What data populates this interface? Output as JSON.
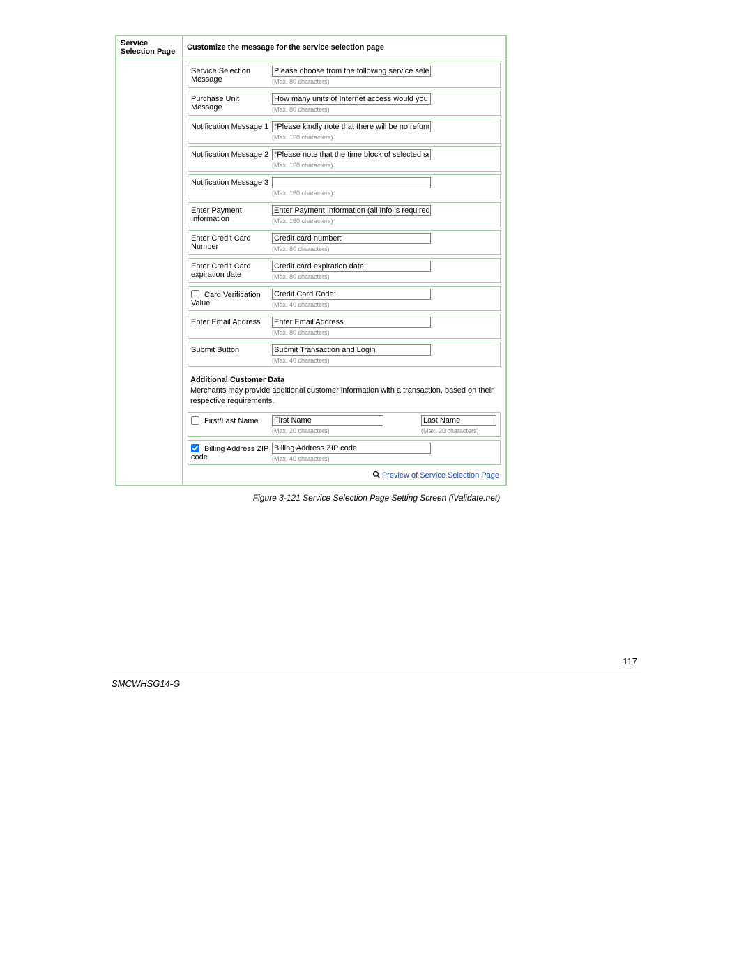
{
  "panel": {
    "left_header": "Service Selection Page",
    "right_header": "Customize the message for the service selection page"
  },
  "rows": {
    "service_selection": {
      "label": "Service Selection Message",
      "value": "Please choose from the following service selection",
      "hint": "(Max. 80 characters)"
    },
    "purchase_unit": {
      "label": "Purchase Unit Message",
      "value": "How many units of Internet access would you like to",
      "hint": "(Max. 80 characters)"
    },
    "notif1": {
      "label": "Notification Message 1",
      "value": "*Please kindly note that there will be no refund once",
      "hint": "(Max. 160 characters)"
    },
    "notif2": {
      "label": "Notification Message 2",
      "value": "*Please note that the time block of selected service",
      "hint": "(Max. 160 characters)"
    },
    "notif3": {
      "label": "Notification Message 3",
      "value": "",
      "hint": "(Max. 160 characters)"
    },
    "payment_info": {
      "label": "Enter Payment Information",
      "value": "Enter Payment Information (all info is required)",
      "hint": "(Max. 160 characters)"
    },
    "cc_number": {
      "label": "Enter Credit Card Number",
      "value": "Credit card number:",
      "hint": "(Max. 80 characters)"
    },
    "cc_exp": {
      "label": "Enter Credit Card expiration date",
      "value": "Credit card expiration date:",
      "hint": "(Max. 80 characters)"
    },
    "cvv": {
      "label": " Card Verification Value",
      "value": "Credit Card Code:",
      "hint": "(Max. 40 characters)"
    },
    "email": {
      "label": "Enter Email Address",
      "value": "Enter Email Address",
      "hint": "(Max. 80 characters)"
    },
    "submit": {
      "label": "Submit Button",
      "value": "Submit Transaction and Login",
      "hint": "(Max. 40 characters)"
    },
    "first_last": {
      "label": " First/Last Name",
      "value1": "First Name",
      "hint1": "(Max. 20 characters)",
      "value2": "Last Name",
      "hint2": "(Max. 20 characters)"
    },
    "billing_zip": {
      "label": " Billing Address ZIP code",
      "value": "Billing Address ZIP code",
      "hint": "(Max. 40 characters)"
    }
  },
  "additional": {
    "title": "Additional Customer Data",
    "desc": "Merchants may provide additional customer information with a transaction, based on their respective requirements."
  },
  "preview_link": "Preview of Service Selection Page",
  "figure_caption": "Figure 3-121 Service Selection Page Setting Screen (iValidate.net)",
  "page_number": "117",
  "model": "SMCWHSG14-G"
}
